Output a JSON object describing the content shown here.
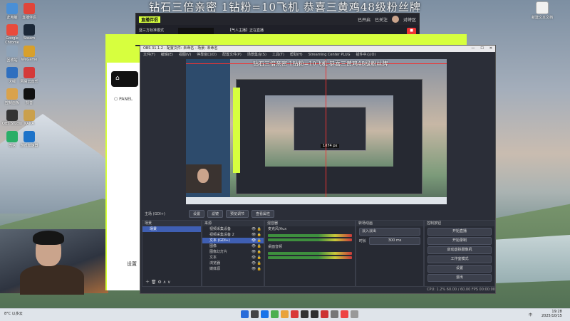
{
  "banner": "钻石三倍亲密 1钻粉=10飞机 恭喜三黄鸡48级粉丝牌",
  "desktop_left": [
    {
      "label": "此电脑",
      "color": "#4a8fd6"
    },
    {
      "label": "Google Chrome",
      "color": "#e94b3c"
    },
    {
      "label": "回收站",
      "color": "#8fa3b8"
    },
    {
      "label": "火绒",
      "color": "#2f6fbf"
    },
    {
      "label": "控制面板",
      "color": "#d9a24b"
    },
    {
      "label": "OBS Studio",
      "color": "#333333"
    },
    {
      "label": "微信",
      "color": "#2aae67"
    },
    {
      "label": "直播伴侣",
      "color": "#e0453a"
    },
    {
      "label": "Steam",
      "color": "#1b2838"
    },
    {
      "label": "WeGame",
      "color": "#d8a02c"
    },
    {
      "label": "网易云音乐",
      "color": "#d43a3a"
    },
    {
      "label": "抖音",
      "color": "#111111"
    },
    {
      "label": "KANA",
      "color": "#caa04c"
    },
    {
      "label": "游戏加速器",
      "color": "#1d73c9"
    }
  ],
  "desktop_right": {
    "label": "新建文本文档",
    "color": "#f0f0f0"
  },
  "live_app": {
    "title": "直播伴侣",
    "mode": "竖三方标准模式",
    "room": "【气人主播】正在直播",
    "status1": "已开启",
    "status2": "已关注",
    "user": "对峙区"
  },
  "side_panel": {
    "item1": "直播",
    "item2": "PANEL",
    "settings": "设置"
  },
  "obs": {
    "title": "OBS 31.1.2 - 配置文件: 未命名 - 场景: 未命名",
    "menu": [
      "文件(F)",
      "编辑(E)",
      "视图(V)",
      "停靠窗口(D)",
      "配置文件(P)",
      "场景集合(S)",
      "工具(T)",
      "帮助(H)",
      "Streaming Center PLUG",
      "插件中心(O)"
    ],
    "preview_label": "1874 px",
    "scene_bar_label": "主场 (GDI+)",
    "buttons": [
      "设置",
      "滤镜",
      "预览调节",
      "查看属性"
    ],
    "docks": {
      "scenes": {
        "title": "场景",
        "items": [
          "场景"
        ]
      },
      "sources": {
        "title": "来源",
        "items": [
          "视频采集设备",
          "视频采集设备 2",
          "文本 (GDI+)",
          "图像",
          "图像幻灯片",
          "文本",
          "浏览器",
          "媒体源"
        ]
      },
      "mixer": {
        "title": "混音器",
        "channels": [
          "麦克风/Aux",
          "桌面音频"
        ]
      },
      "transitions": {
        "title": "转场动画",
        "type": "淡入淡出",
        "duration_label": "时长",
        "duration": "300 ms"
      },
      "controls": {
        "title": "控制按钮",
        "buttons": [
          "开始直播",
          "开始录制",
          "启动虚拟摄像机",
          "工作室模式",
          "设置",
          "退出"
        ]
      }
    },
    "status": "CPU: 1.2%   60.00 / 60.00 FPS   00:00:00"
  },
  "taskbar": {
    "weather": "8°C 以多云",
    "time": "19:28",
    "date": "2025/10/15",
    "lang": "中"
  }
}
